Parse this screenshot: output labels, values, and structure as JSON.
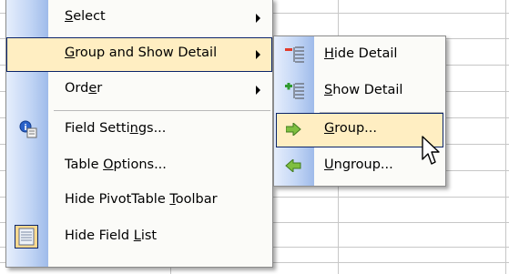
{
  "menu": {
    "items": [
      {
        "pre": "",
        "ul": "S",
        "post": "elect",
        "submenu": true
      },
      {
        "pre": "",
        "ul": "G",
        "post": "roup and Show Detail",
        "submenu": true
      },
      {
        "pre": "Ord",
        "ul": "e",
        "post": "r",
        "submenu": true
      },
      {
        "pre": "Field Setti",
        "ul": "n",
        "post": "gs...",
        "submenu": false
      },
      {
        "pre": "Table ",
        "ul": "O",
        "post": "ptions...",
        "submenu": false
      },
      {
        "pre": "Hide PivotTable ",
        "ul": "T",
        "post": "oolbar",
        "submenu": false
      },
      {
        "pre": "Hide Field ",
        "ul": "L",
        "post": "ist",
        "submenu": false
      }
    ]
  },
  "submenu": {
    "items": [
      {
        "pre": "",
        "ul": "H",
        "post": "ide Detail"
      },
      {
        "pre": "",
        "ul": "S",
        "post": "how Detail"
      },
      {
        "pre": "",
        "ul": "G",
        "post": "roup..."
      },
      {
        "pre": "",
        "ul": "U",
        "post": "ngroup..."
      }
    ]
  },
  "colors": {
    "highlight": "#ffeec2",
    "highlight_border": "#0a246a",
    "menu_bg": "#fbfbf8",
    "icon_stripe": "#c3d6f5",
    "grid": "#c7c7c7"
  },
  "icons": [
    "field-settings-icon",
    "hide-field-list-icon",
    "hide-detail-icon",
    "show-detail-icon",
    "group-arrow-icon",
    "ungroup-arrow-icon"
  ]
}
